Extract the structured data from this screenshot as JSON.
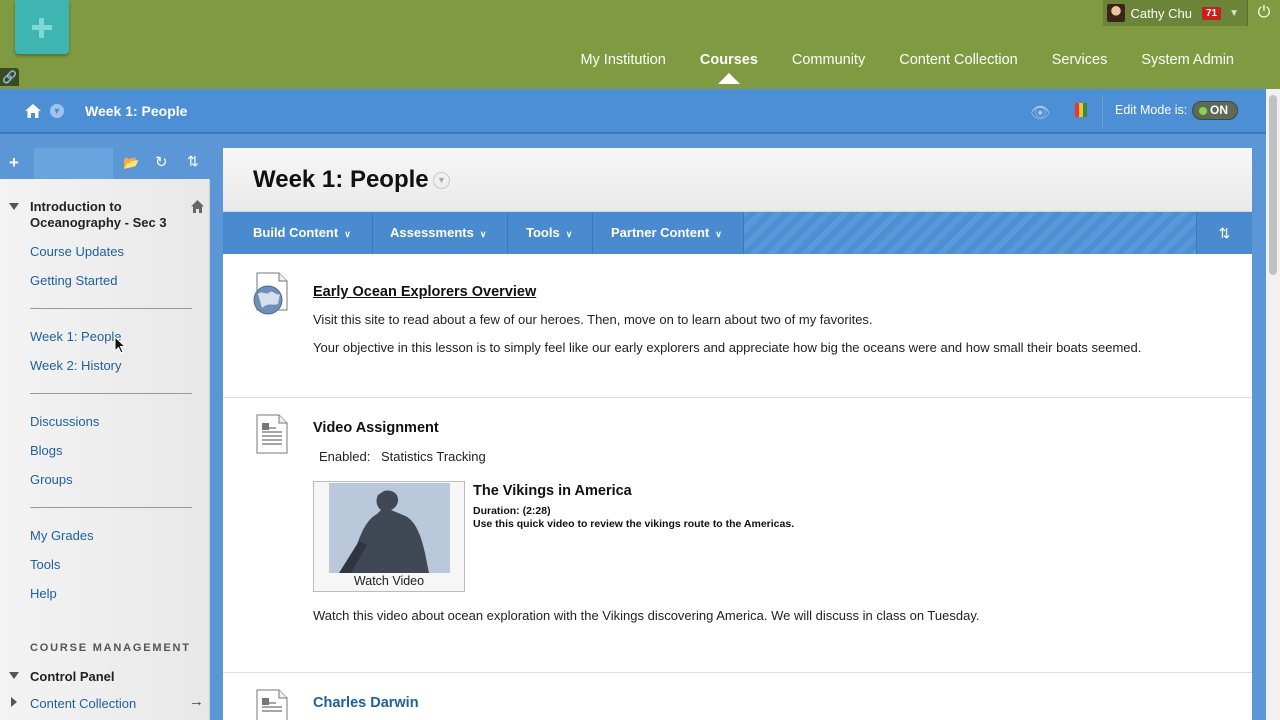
{
  "header": {
    "user_name": "Cathy Chu",
    "notification_count": "71",
    "nav_tabs": [
      {
        "label": "My Institution"
      },
      {
        "label": "Courses",
        "active": true
      },
      {
        "label": "Community"
      },
      {
        "label": "Content Collection"
      },
      {
        "label": "Services"
      },
      {
        "label": "System Admin"
      }
    ]
  },
  "breadcrumb": {
    "title": "Week 1: People",
    "edit_mode_label": "Edit Mode is:",
    "edit_mode_value": "ON"
  },
  "sidebar": {
    "course_title": "Introduction to Oceanography - Sec 3",
    "group1": [
      "Course Updates",
      "Getting Started"
    ],
    "group2": [
      "Week 1: People",
      "Week 2: History"
    ],
    "group3": [
      "Discussions",
      "Blogs",
      "Groups"
    ],
    "group4": [
      "My Grades",
      "Tools",
      "Help"
    ],
    "management_label": "COURSE MANAGEMENT",
    "control_panel": "Control Panel",
    "content_collection": "Content Collection"
  },
  "content": {
    "page_title": "Week 1: People",
    "action_buttons": [
      "Build Content",
      "Assessments",
      "Tools",
      "Partner Content"
    ],
    "items": [
      {
        "title": "Early Ocean Explorers Overview",
        "lines": [
          "Visit this site to read about a few of our heroes. Then, move on to learn about two of my favorites.",
          "Your objective in this lesson is to simply feel like our early explorers and appreciate how big the oceans were and how small their boats seemed."
        ]
      },
      {
        "title": "Video Assignment",
        "enabled_label": "Enabled:",
        "enabled_value": "Statistics Tracking",
        "video": {
          "title": "The Vikings in America",
          "duration": "Duration: (2:28)",
          "description": "Use this quick video to review the vikings route to the Americas.",
          "button": "Watch Video"
        },
        "summary": "Watch this video about ocean exploration with the Vikings discovering America. We will discuss in class on Tuesday."
      },
      {
        "title": "Charles Darwin"
      }
    ]
  },
  "colors": {
    "header_green": "#7f9a41",
    "nav_blue": "#4d8fd4",
    "link_blue": "#1e5f9e"
  }
}
